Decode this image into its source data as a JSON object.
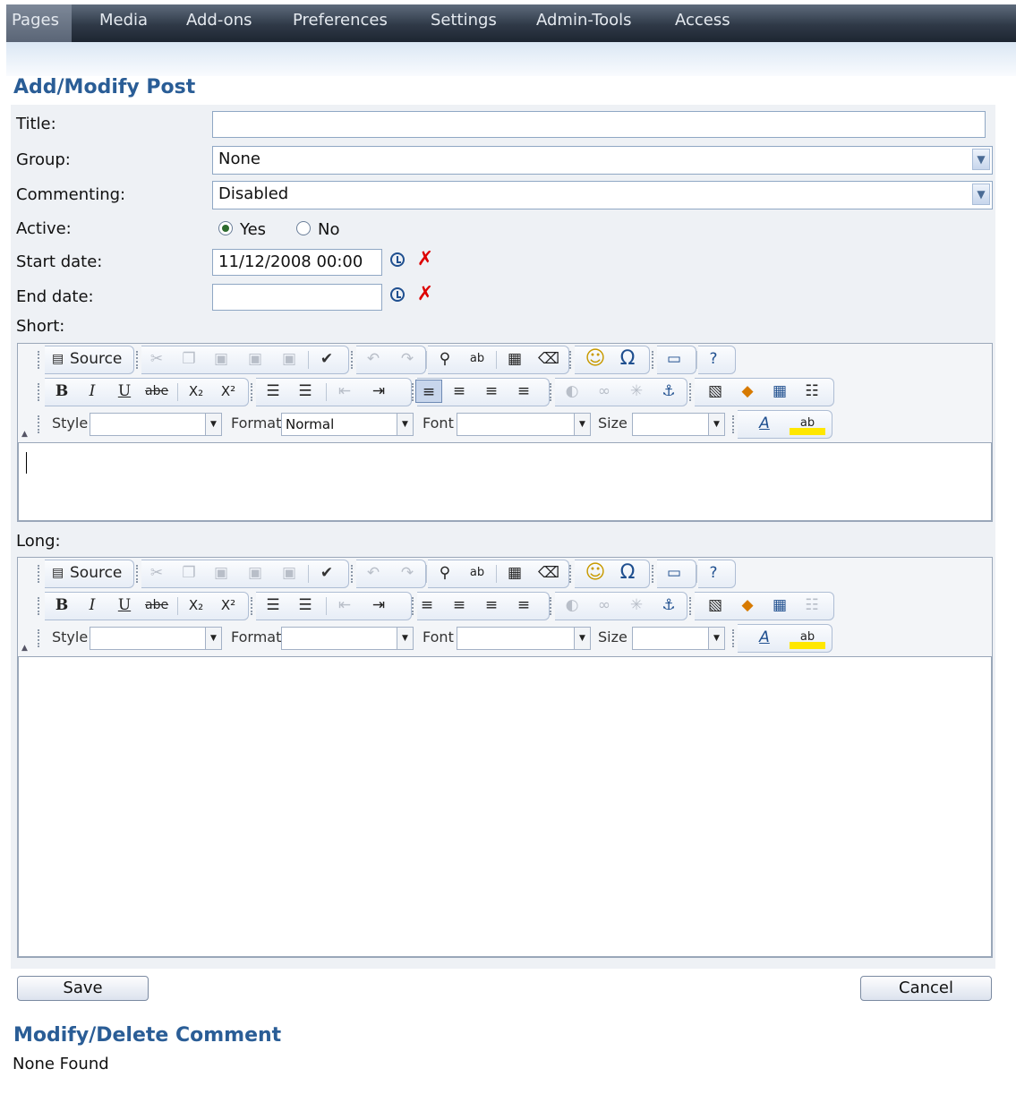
{
  "nav": {
    "tabs": [
      "Pages",
      "Media",
      "Add-ons",
      "Preferences",
      "Settings",
      "Admin-Tools",
      "Access"
    ]
  },
  "form": {
    "heading": "Add/Modify Post",
    "title_label": "Title:",
    "title_value": "",
    "group_label": "Group:",
    "group_value": "None",
    "commenting_label": "Commenting:",
    "commenting_value": "Disabled",
    "active_label": "Active:",
    "active_yes": "Yes",
    "active_no": "No",
    "active_selected": "Yes",
    "start_label": "Start date:",
    "start_value": "11/12/2008 00:00",
    "end_label": "End date:",
    "end_value": "",
    "short_label": "Short:",
    "long_label": "Long:"
  },
  "editor": {
    "source_label": "Source",
    "style_label": "Style",
    "format_label": "Format",
    "font_label": "Font",
    "size_label": "Size",
    "short_format_value": "Normal",
    "long_format_value": "",
    "glyphs": {
      "bold": "B",
      "italic": "I",
      "underline": "U",
      "strike": "abe",
      "subscript": "X₂",
      "superscript": "X²",
      "omega": "Ω",
      "smiley": "☺",
      "anchor": "⚓",
      "textcolor": "A",
      "bgcolor": "ab"
    }
  },
  "buttons": {
    "save": "Save",
    "cancel": "Cancel"
  },
  "comments": {
    "heading": "Modify/Delete Comment",
    "empty": "None Found"
  },
  "colors": {
    "heading": "#2a5d96",
    "nav_bg": "#2f3947",
    "form_bg": "#eef1f5"
  }
}
